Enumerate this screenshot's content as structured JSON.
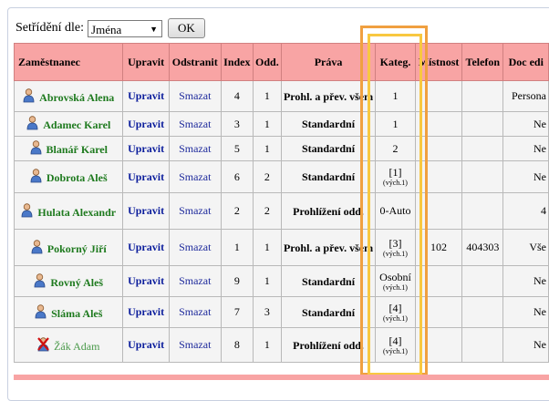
{
  "sort": {
    "label": "Setřídění dle:",
    "selected": "Jména",
    "ok_label": "OK"
  },
  "columns": [
    "Zaměstnanec",
    "Upravit",
    "Odstranit",
    "Index",
    "Odd.",
    "Práva",
    "Kateg.",
    "Místnost",
    "Telefon",
    "Doc edi"
  ],
  "rows": [
    {
      "name": "Abrovská Alena",
      "edit": "Upravit",
      "delete": "Smazat",
      "index": "4",
      "odd": "1",
      "prava": "Prohl. a přev. všem",
      "kateg": "1",
      "kateg_sub": "",
      "mistnost": "",
      "telefon": "",
      "doc": "Persona",
      "deleted": false
    },
    {
      "name": "Adamec Karel",
      "edit": "Upravit",
      "delete": "Smazat",
      "index": "3",
      "odd": "1",
      "prava": "Standardní",
      "kateg": "1",
      "kateg_sub": "",
      "mistnost": "",
      "telefon": "",
      "doc": "Ne",
      "deleted": false
    },
    {
      "name": "Blanář Karel",
      "edit": "Upravit",
      "delete": "Smazat",
      "index": "5",
      "odd": "1",
      "prava": "Standardní",
      "kateg": "2",
      "kateg_sub": "",
      "mistnost": "",
      "telefon": "",
      "doc": "Ne",
      "deleted": false
    },
    {
      "name": "Dobrota Aleš",
      "edit": "Upravit",
      "delete": "Smazat",
      "index": "6",
      "odd": "2",
      "prava": "Standardní",
      "kateg": "[1]",
      "kateg_sub": "(vých.1)",
      "mistnost": "",
      "telefon": "",
      "doc": "Ne",
      "deleted": false
    },
    {
      "name": "Hulata Alexandr",
      "edit": "Upravit",
      "delete": "Smazat",
      "index": "2",
      "odd": "2",
      "prava": "Prohlížení odd.",
      "kateg": "0-Auto",
      "kateg_sub": "",
      "mistnost": "",
      "telefon": "",
      "doc": "4",
      "deleted": false
    },
    {
      "name": "Pokorný Jiří",
      "edit": "Upravit",
      "delete": "Smazat",
      "index": "1",
      "odd": "1",
      "prava": "Prohl. a přev. všem",
      "kateg": "[3]",
      "kateg_sub": "(vých.1)",
      "mistnost": "102",
      "telefon": "404303",
      "doc": "Vše",
      "deleted": false
    },
    {
      "name": "Rovný Aleš",
      "edit": "Upravit",
      "delete": "Smazat",
      "index": "9",
      "odd": "1",
      "prava": "Standardní",
      "kateg": "Osobní",
      "kateg_sub": "(vých.1)",
      "mistnost": "",
      "telefon": "",
      "doc": "Ne",
      "deleted": false
    },
    {
      "name": "Sláma Aleš",
      "edit": "Upravit",
      "delete": "Smazat",
      "index": "7",
      "odd": "3",
      "prava": "Standardní",
      "kateg": "[4]",
      "kateg_sub": "(vých.1)",
      "mistnost": "",
      "telefon": "",
      "doc": "Ne",
      "deleted": false
    },
    {
      "name": "Žák Adam",
      "edit": "Upravit",
      "delete": "Smazat",
      "index": "8",
      "odd": "1",
      "prava": "Prohlížení odd.",
      "kateg": "[4]",
      "kateg_sub": "(vých.1)",
      "mistnost": "",
      "telefon": "",
      "doc": "Ne",
      "deleted": true
    }
  ],
  "colors": {
    "header_bg": "#f8a4a4",
    "name_green": "#1e7a1e",
    "link_blue": "#0b1d9c",
    "highlight_orange": "#f0a040",
    "highlight_yellow": "#f8c840"
  }
}
